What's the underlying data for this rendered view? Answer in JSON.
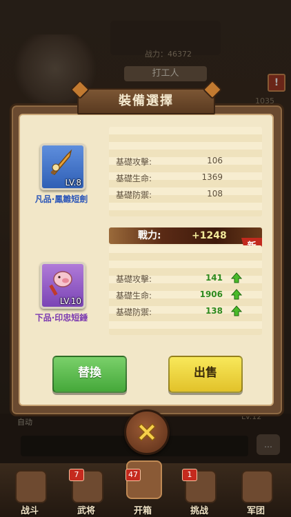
{
  "background": {
    "power_label": "战力：46372",
    "job_label": "打工人",
    "alert_symbol": "!",
    "side_number": "1035",
    "auto_label": "自动",
    "level_label": "Lv.12"
  },
  "dialog": {
    "title": "裝備選擇",
    "current_item": {
      "name": "凡品·鳳雛短劍",
      "level": "LV.8",
      "icon": "sword-icon",
      "stats": [
        {
          "label": "基礎攻擊:",
          "value": "106"
        },
        {
          "label": "基礎生命:",
          "value": "1369"
        },
        {
          "label": "基礎防禦:",
          "value": "108"
        }
      ]
    },
    "power_diff": {
      "label": "戰力:",
      "value": "+1248"
    },
    "new_badge": "新",
    "new_item": {
      "name": "下品·印忠短錘",
      "level": "LV.10",
      "icon": "pig-hammer-icon",
      "stats": [
        {
          "label": "基礎攻擊:",
          "value": "141"
        },
        {
          "label": "基礎生命:",
          "value": "1906"
        },
        {
          "label": "基礎防禦:",
          "value": "138"
        }
      ]
    },
    "replace_button": "替換",
    "sell_button": "出售"
  },
  "bottom_nav": [
    {
      "label": "战斗",
      "badge": ""
    },
    {
      "label": "武将",
      "badge": "7"
    },
    {
      "label": "开箱",
      "badge": "47"
    },
    {
      "label": "挑战",
      "badge": "1"
    },
    {
      "label": "军团",
      "badge": ""
    }
  ],
  "colors": {
    "panel_bg": "#f2e7c8",
    "blue_rarity": "#2a55b8",
    "purple_rarity": "#7a38b0",
    "stat_up": "#2e8a1e"
  }
}
